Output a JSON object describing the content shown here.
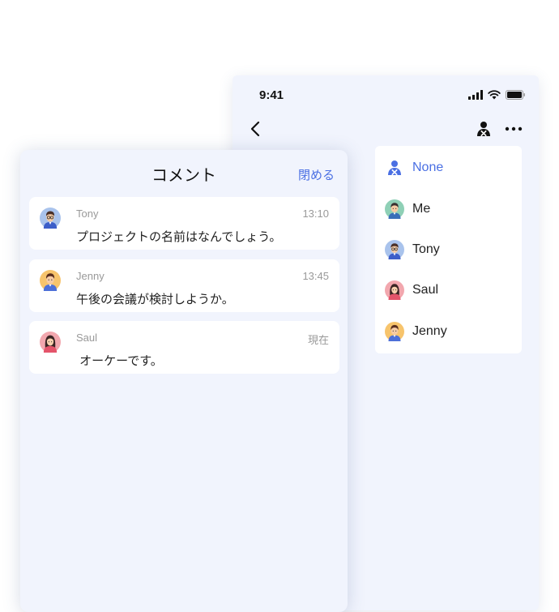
{
  "status_bar": {
    "time": "9:41"
  },
  "assignee_menu": {
    "items": [
      {
        "label": "None",
        "avatar": "unassigned-user-icon",
        "selected": true
      },
      {
        "label": "Me",
        "avatar": "avatar-me"
      },
      {
        "label": "Tony",
        "avatar": "avatar-tony"
      },
      {
        "label": "Saul",
        "avatar": "avatar-saul"
      },
      {
        "label": "Jenny",
        "avatar": "avatar-jenny"
      }
    ]
  },
  "comments_panel": {
    "title": "コメント",
    "close_label": "閉める",
    "comments": [
      {
        "author": "Tony",
        "time": "13:10",
        "text": "プロジェクトの名前はなんでしょう。"
      },
      {
        "author": "Jenny",
        "time": "13:45",
        "text": "午後の会議が検討しようか。"
      },
      {
        "author": "Saul",
        "time": "現在",
        "text": " オーケーです。"
      }
    ]
  },
  "colors": {
    "accent": "#4a6fe3",
    "background": "#f1f4fd",
    "card": "#ffffff"
  }
}
